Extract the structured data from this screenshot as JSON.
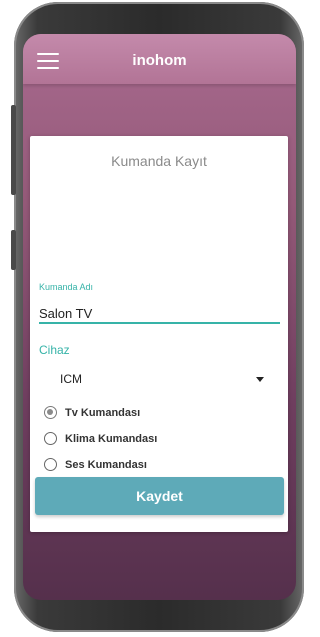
{
  "app": {
    "title": "inohom"
  },
  "form": {
    "heading": "Kumanda Kayıt",
    "name_label": "Kumanda Adı",
    "name_value": "Salon TV",
    "device_label": "Cihaz",
    "device_selected": "ICM",
    "radios": [
      {
        "label": "Tv Kumandası",
        "checked": true
      },
      {
        "label": "Klima Kumandası",
        "checked": false
      },
      {
        "label": "Ses Kumandası",
        "checked": false
      }
    ],
    "save_label": "Kaydet"
  },
  "colors": {
    "accent": "#36b3a8",
    "button": "#5eaab8",
    "appbar": "#b27496",
    "background": "#945978"
  }
}
